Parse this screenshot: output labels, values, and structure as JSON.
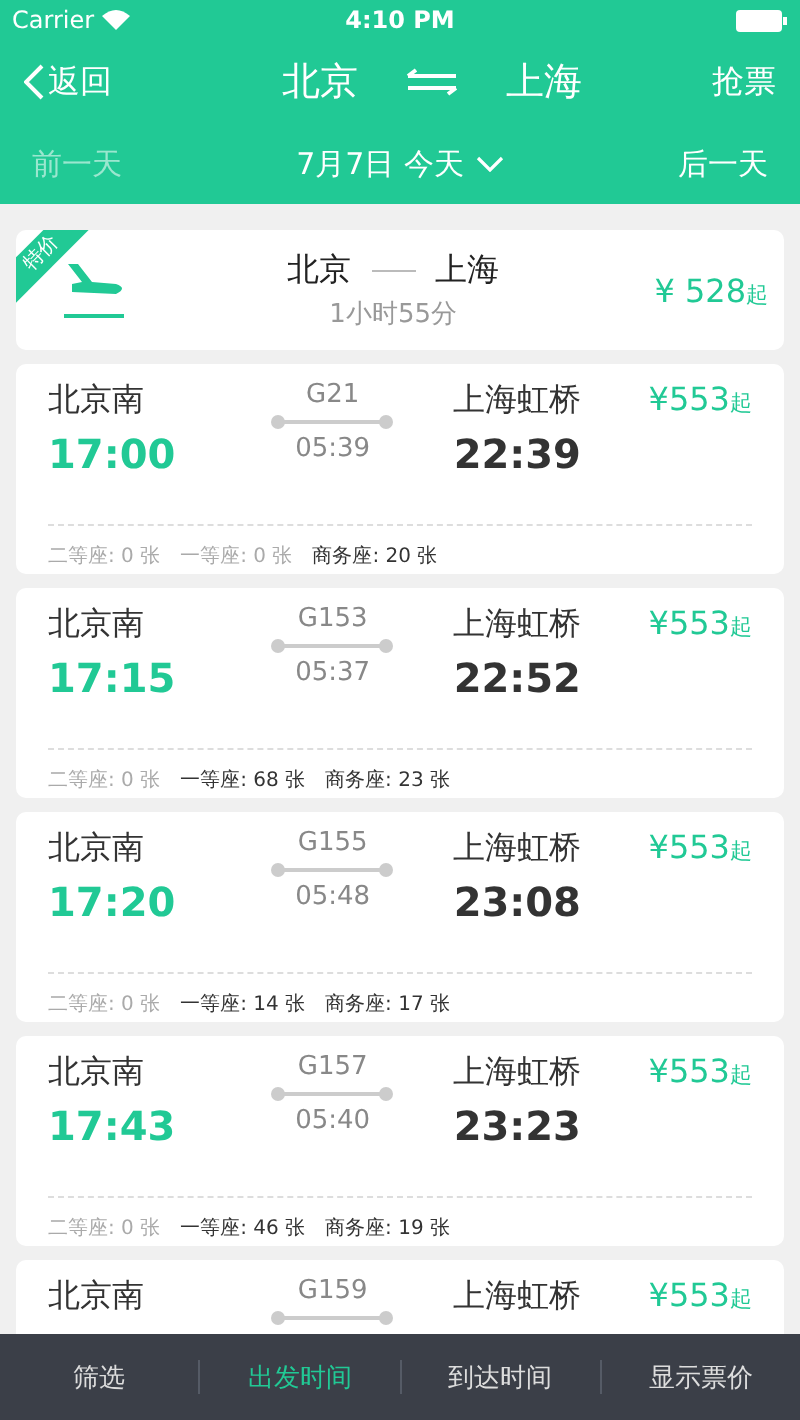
{
  "status_bar": {
    "carrier": "Carrier",
    "time": "4:10 PM"
  },
  "nav": {
    "back": "返回",
    "from": "北京",
    "to": "上海",
    "action": "抢票"
  },
  "date_bar": {
    "prev": {
      "label": "前一天",
      "disabled": true
    },
    "date": "7月7日 今天",
    "next": {
      "label": "后一天",
      "disabled": false
    }
  },
  "flight": {
    "badge": "特价",
    "from": "北京",
    "to": "上海",
    "duration": "1小时55分",
    "price": "¥ 528",
    "price_suffix": "起"
  },
  "trains": [
    {
      "from": "北京南",
      "depart": "17:00",
      "number": "G21",
      "duration": "05:39",
      "to": "上海虹桥",
      "arrive": "22:39",
      "price": "¥553",
      "price_suffix": "起",
      "seats": [
        {
          "label": "二等座: 0 张",
          "available": false
        },
        {
          "label": "一等座: 0 张",
          "available": false
        },
        {
          "label": "商务座: 20 张",
          "available": true
        }
      ]
    },
    {
      "from": "北京南",
      "depart": "17:15",
      "number": "G153",
      "duration": "05:37",
      "to": "上海虹桥",
      "arrive": "22:52",
      "price": "¥553",
      "price_suffix": "起",
      "seats": [
        {
          "label": "二等座: 0 张",
          "available": false
        },
        {
          "label": "一等座: 68 张",
          "available": true
        },
        {
          "label": "商务座: 23 张",
          "available": true
        }
      ]
    },
    {
      "from": "北京南",
      "depart": "17:20",
      "number": "G155",
      "duration": "05:48",
      "to": "上海虹桥",
      "arrive": "23:08",
      "price": "¥553",
      "price_suffix": "起",
      "seats": [
        {
          "label": "二等座: 0 张",
          "available": false
        },
        {
          "label": "一等座: 14 张",
          "available": true
        },
        {
          "label": "商务座: 17 张",
          "available": true
        }
      ]
    },
    {
      "from": "北京南",
      "depart": "17:43",
      "number": "G157",
      "duration": "05:40",
      "to": "上海虹桥",
      "arrive": "23:23",
      "price": "¥553",
      "price_suffix": "起",
      "seats": [
        {
          "label": "二等座: 0 张",
          "available": false
        },
        {
          "label": "一等座: 46 张",
          "available": true
        },
        {
          "label": "商务座: 19 张",
          "available": true
        }
      ]
    },
    {
      "from": "北京南",
      "number": "G159",
      "to": "上海虹桥",
      "price": "¥553",
      "price_suffix": "起"
    }
  ],
  "bottom_tabs": [
    {
      "label": "筛选",
      "selected": false
    },
    {
      "label": "出发时间",
      "selected": true
    },
    {
      "label": "到达时间",
      "selected": false
    },
    {
      "label": "显示票价",
      "selected": false
    }
  ]
}
